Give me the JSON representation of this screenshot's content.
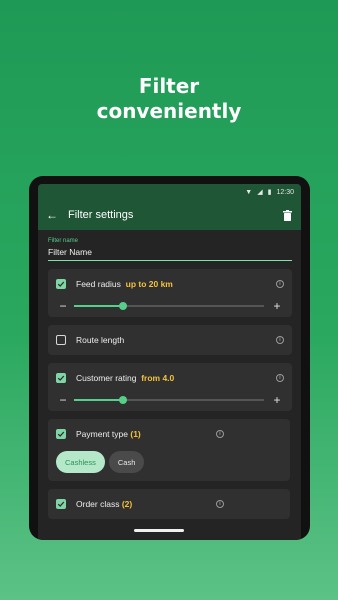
{
  "promo": {
    "line1": "Filter",
    "line2": "conveniently"
  },
  "statusbar": {
    "time": "12:30"
  },
  "appbar": {
    "title": "Filter settings",
    "back_icon": "arrow-back-icon",
    "delete_icon": "trash-icon"
  },
  "filter_name": {
    "label": "Filter name",
    "value": "Filter Name"
  },
  "feed_radius": {
    "label": "Feed radius",
    "value_text": "up to 20 km",
    "checked": true,
    "slider_fraction": 0.26,
    "minus": "−",
    "plus": "+"
  },
  "route_length": {
    "label": "Route length",
    "checked": false
  },
  "customer_rating": {
    "label": "Customer rating",
    "value_text": "from 4.0",
    "checked": true,
    "slider_fraction": 0.26,
    "minus": "−",
    "plus": "+"
  },
  "payment_type": {
    "label": "Payment type",
    "count": "(1)",
    "checked": true,
    "options": [
      "Cashless",
      "Cash"
    ],
    "selected": "Cashless"
  },
  "order_class": {
    "label": "Order class",
    "count": "(2)",
    "checked": true
  },
  "colors": {
    "accent": "#f6c13a",
    "brand_green": "#1e5636",
    "check_green": "#7ed6a5"
  }
}
